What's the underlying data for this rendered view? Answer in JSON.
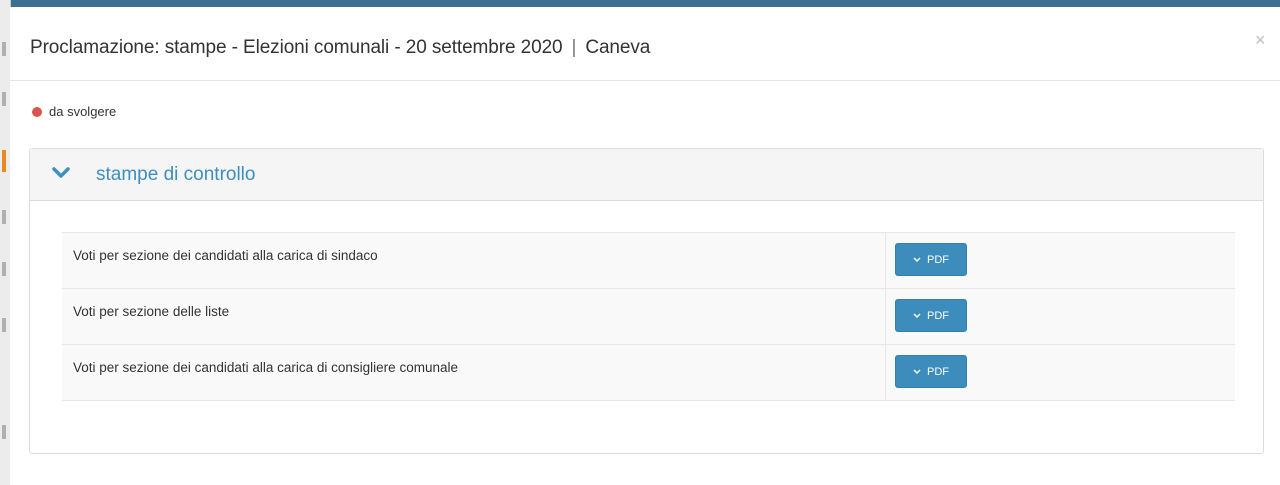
{
  "modal": {
    "title": "Proclamazione: stampe - Elezioni comunali - 20 settembre 2020",
    "separator": "|",
    "comune": "Caneva",
    "close_symbol": "×"
  },
  "status": {
    "label": "da svolgere",
    "color": "#d9534f"
  },
  "panel": {
    "title": "stampe di controllo",
    "icon": "chevron-down-icon",
    "accent_color": "#3d8fc0"
  },
  "rows": [
    {
      "label": "Voti per sezione dei candidati alla carica di sindaco",
      "button": "PDF"
    },
    {
      "label": "Voti per sezione delle liste",
      "button": "PDF"
    },
    {
      "label": "Voti per sezione dei candidati alla carica di consigliere comunale",
      "button": "PDF"
    }
  ],
  "colors": {
    "button": "#3c8dbc",
    "header_bar": "#3d6f93"
  }
}
